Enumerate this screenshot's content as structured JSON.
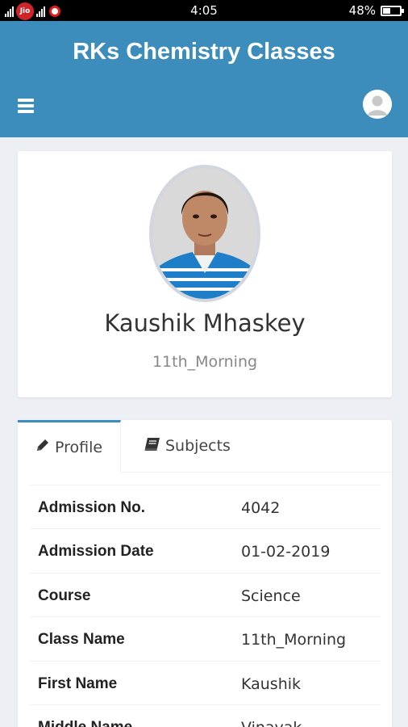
{
  "status_bar": {
    "carrier_badge": "Jio",
    "time": "4:05",
    "battery": "48%"
  },
  "header": {
    "title": "RKs Chemistry Classes",
    "menu_icon": "hamburger-menu-icon",
    "user_icon": "user-avatar-icon",
    "color": "#3c8dbc"
  },
  "profile": {
    "name": "Kaushik Mhaskey",
    "class_name": "11th_Morning"
  },
  "tabs": [
    {
      "label": "Profile",
      "icon": "pencil-icon",
      "active": true
    },
    {
      "label": "Subjects",
      "icon": "book-icon",
      "active": false
    }
  ],
  "details": [
    {
      "label": "Admission No.",
      "value": "4042"
    },
    {
      "label": "Admission Date",
      "value": "01-02-2019"
    },
    {
      "label": "Course",
      "value": "Science"
    },
    {
      "label": "Class Name",
      "value": "11th_Morning"
    },
    {
      "label": "First Name",
      "value": "Kaushik"
    },
    {
      "label": "Middle Name",
      "value": "Vinayak"
    }
  ]
}
